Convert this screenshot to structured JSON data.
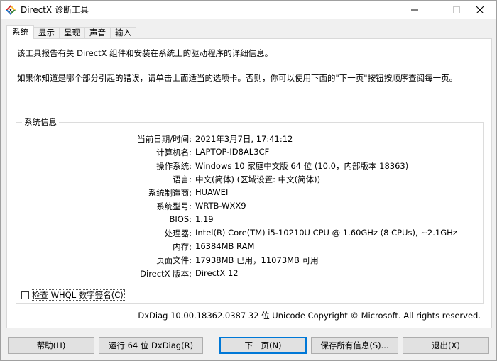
{
  "window": {
    "title": "DirectX 诊断工具",
    "controls": {
      "minimize": "—",
      "maximize": "☐",
      "close": "✕"
    }
  },
  "tabs": [
    {
      "label": "系统",
      "active": true
    },
    {
      "label": "显示",
      "active": false
    },
    {
      "label": "呈现",
      "active": false
    },
    {
      "label": "声音",
      "active": false
    },
    {
      "label": "输入",
      "active": false
    }
  ],
  "intro": {
    "line1": "该工具报告有关 DirectX 组件和安装在系统上的驱动程序的详细信息。",
    "line2": "如果你知道是哪个部分引起的错误，请单击上面适当的选项卡。否则，你可以使用下面的\"下一页\"按钮按顺序查阅每一页。"
  },
  "system_info": {
    "group_title": "系统信息",
    "rows": [
      {
        "label": "当前日期/时间:",
        "value": "2021年3月7日, 17:41:12"
      },
      {
        "label": "计算机名:",
        "value": "LAPTOP-ID8AL3CF"
      },
      {
        "label": "操作系统:",
        "value": "Windows 10 家庭中文版 64 位 (10.0，内部版本 18363)"
      },
      {
        "label": "语言:",
        "value": "中文(简体) (区域设置: 中文(简体))"
      },
      {
        "label": "系统制造商:",
        "value": "HUAWEI"
      },
      {
        "label": "系统型号:",
        "value": "WRTB-WXX9"
      },
      {
        "label": "BIOS:",
        "value": "1.19"
      },
      {
        "label": "处理器:",
        "value": "Intel(R) Core(TM) i5-10210U CPU @ 1.60GHz (8 CPUs), ~2.1GHz"
      },
      {
        "label": "内存:",
        "value": "16384MB RAM"
      },
      {
        "label": "页面文件:",
        "value": "17938MB 已用，11073MB 可用"
      },
      {
        "label": "DirectX 版本:",
        "value": "DirectX 12"
      }
    ]
  },
  "whql_checkbox": {
    "label": "检查 WHQL 数字签名(C)",
    "checked": false
  },
  "footer": "DxDiag 10.00.18362.0387 32 位 Unicode  Copyright © Microsoft. All rights reserved.",
  "buttons": {
    "help": "帮助(H)",
    "run64": "运行 64 位 DxDiag(R)",
    "next": "下一页(N)",
    "save": "保存所有信息(S)...",
    "exit": "退出(X)"
  },
  "colors": {
    "accent": "#0078d7",
    "panel_bg": "#ffffff",
    "window_bg": "#f0f0f0"
  }
}
